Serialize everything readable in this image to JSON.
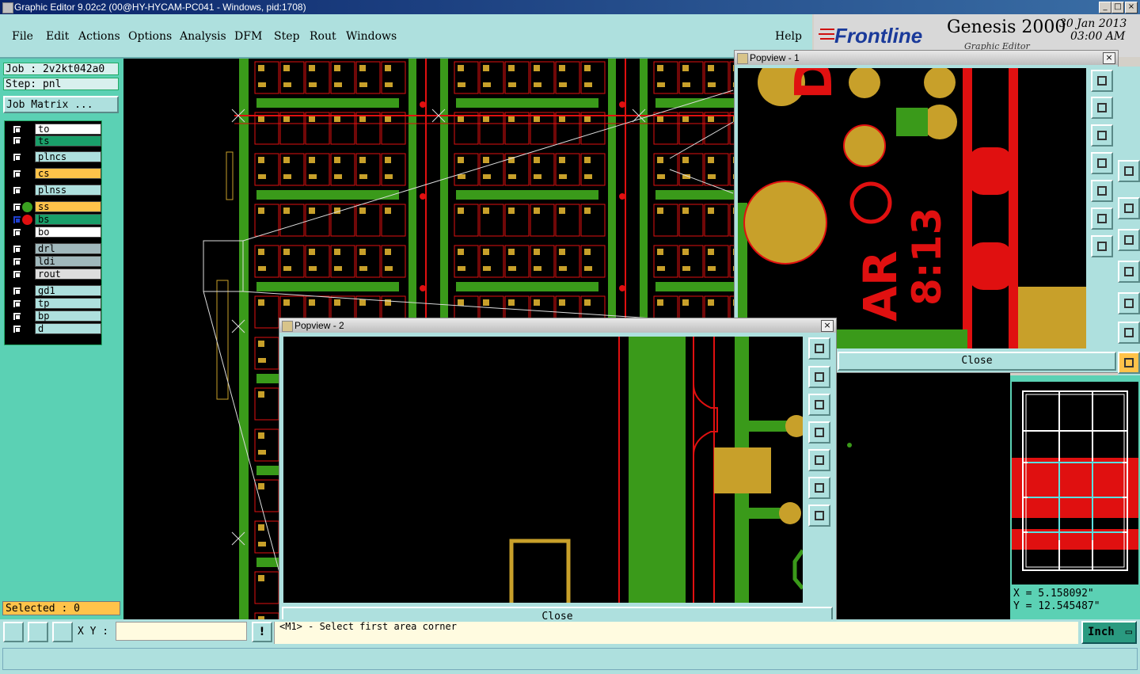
{
  "window": {
    "title": "Graphic Editor 9.02c2 (00@HY-HYCAM-PC041 - Windows, pid:1708)",
    "min": "_",
    "max": "□",
    "close": "×"
  },
  "menu": [
    "File",
    "Edit",
    "Actions",
    "Options",
    "Analysis",
    "DFM",
    "Step",
    "Rout",
    "Windows",
    "Help"
  ],
  "brand": {
    "logo": "Frontline",
    "product": "Genesis 2000",
    "subtitle": "Graphic Editor",
    "date": "30 Jan 2013",
    "time": "03:00 AM"
  },
  "job": {
    "job_label": "Job : 2v2kt042a0",
    "step_label": "Step: pnl",
    "matrix_button": "Job Matrix ..."
  },
  "layers": [
    {
      "name": "to",
      "color": "#ffffff"
    },
    {
      "name": "ts",
      "color": "#1a9f6a"
    },
    {
      "name": "plncs",
      "color": "#aee0de"
    },
    {
      "name": "cs",
      "color": "#ffc34a"
    },
    {
      "name": "plnss",
      "color": "#aee0de"
    },
    {
      "name": "ss",
      "color": "#ffc34a"
    },
    {
      "name": "bs",
      "color": "#1a9f6a"
    },
    {
      "name": "bo",
      "color": "#ffffff"
    },
    {
      "name": "drl",
      "color": "#a0b8bc"
    },
    {
      "name": "ldi",
      "color": "#a0b8bc"
    },
    {
      "name": "rout",
      "color": "#dddddd"
    },
    {
      "name": "gd1",
      "color": "#aee0de"
    },
    {
      "name": "tp",
      "color": "#aee0de"
    },
    {
      "name": "bp",
      "color": "#aee0de"
    },
    {
      "name": "d",
      "color": "#aee0de"
    }
  ],
  "selected": "Selected : 0",
  "popview1": {
    "title": "Popview - 1",
    "close": "Close"
  },
  "popview2": {
    "title": "Popview - 2",
    "close": "Close"
  },
  "coords": {
    "x": "X =  5.158092\"",
    "y": "Y = 12.545487\""
  },
  "bottom": {
    "xy_label": "X Y :",
    "xy_value": "",
    "info_button": "!",
    "prompt": "<M1> - Select first area corner",
    "units": "Inch"
  },
  "colors": {
    "copper": "#c8a02a",
    "green": "#3a9a1a",
    "red": "#e01010",
    "panel": "#aee0de",
    "teal": "#5bd1b4"
  }
}
